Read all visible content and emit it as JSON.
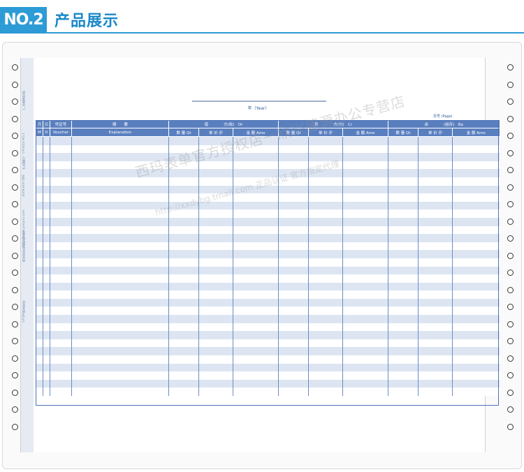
{
  "header": {
    "badge": "NO.2",
    "title": "产品展示"
  },
  "form": {
    "year_label": "年（Year）",
    "page_label": "页号 (Page)",
    "stub_lines": [
      "UFIDA用友软件",
      "用友软件股份有限公司",
      "http://www.yonyou.com",
      "4006-600-588",
      "产品编号：UF0414  NO.1",
      "广州鑫源印刷"
    ],
    "headers": {
      "month": "月",
      "day": "日",
      "voucher": "凭证号",
      "summary": "摘　　要",
      "debit": "借　　　　方(收)　Dr",
      "credit": "贷　　　　方(付)　Cr",
      "balance": "余　　　　(结存)　Ba",
      "m": "M",
      "d": "D",
      "voucher_en": "Voucher",
      "explanation": "Explanation",
      "qty": "数 量 Qt",
      "price": "单 价 ＠",
      "amount": "金 额 Amo"
    }
  },
  "watermark": {
    "line1": "西玛表单官方授权店一欣兴德源办公专营店",
    "line2": "http://xxdybg.tmall.com 正品认证 官方指定代理"
  },
  "colors": {
    "accent": "#2d9bd6",
    "header_fill": "#5a7fbf",
    "row_band": "#dde5f2"
  }
}
